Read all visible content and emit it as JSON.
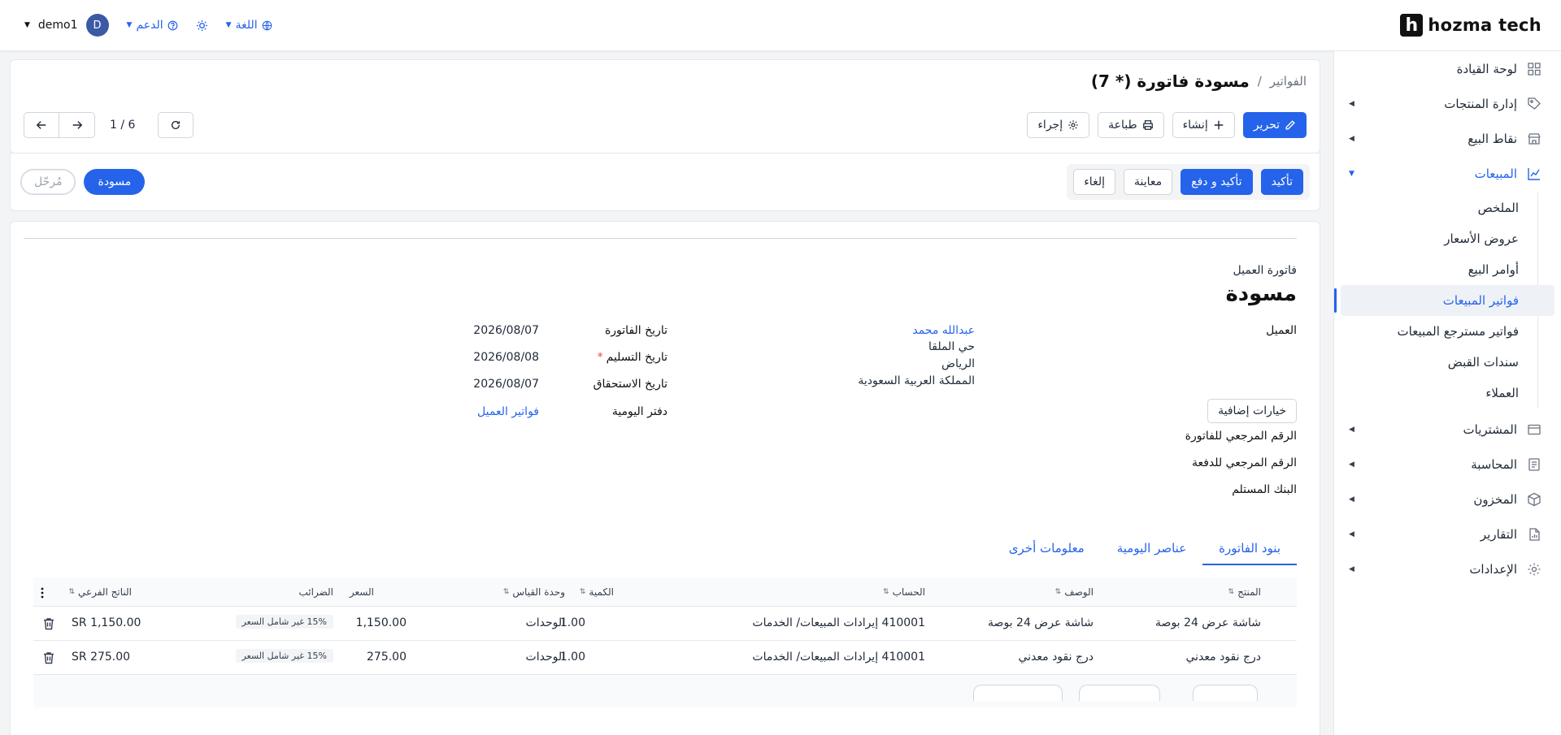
{
  "topbar": {
    "brand": "hozma tech",
    "brand_mark": "h",
    "user_name": "demo1",
    "user_initial": "D",
    "support_label": "الدعم",
    "language_label": "اللغة"
  },
  "sidebar": {
    "items": [
      {
        "label": "لوحة القيادة",
        "icon": "dashboard-icon"
      },
      {
        "label": "إدارة المنتجات",
        "icon": "tag-icon"
      },
      {
        "label": "نقاط البيع",
        "icon": "store-icon"
      },
      {
        "label": "المبيعات",
        "icon": "chart-icon"
      },
      {
        "label": "المشتريات",
        "icon": "card-icon"
      },
      {
        "label": "المحاسبة",
        "icon": "ledger-icon"
      },
      {
        "label": "المخزون",
        "icon": "box-icon"
      },
      {
        "label": "التقارير",
        "icon": "report-icon"
      },
      {
        "label": "الإعدادات",
        "icon": "gear-icon"
      }
    ],
    "sales_sub": [
      "الملخص",
      "عروض الأسعار",
      "أوامر البيع",
      "فواتير المبيعات",
      "فواتير مسترجع المبيعات",
      "سندات القبض",
      "العملاء"
    ]
  },
  "header": {
    "breadcrumb_parent": "الفواتير",
    "separator": "/",
    "title": "مسودة فاتورة (* 7)",
    "edit_label": "تحرير",
    "create_label": "إنشاء",
    "print_label": "طباعة",
    "action_label": "إجراء",
    "pager": "1 / 6"
  },
  "status_bar": {
    "confirm_label": "تأكيد",
    "confirm_pay_label": "تأكيد و دفع",
    "preview_label": "معاينة",
    "cancel_label": "إلغاء",
    "status_draft": "مسودة",
    "status_posted": "مُرحّل"
  },
  "document": {
    "type": "فاتورة العميل",
    "state": "مسودة",
    "customer_label": "العميل",
    "customer_name": "عبدالله محمد",
    "address_line1": "حي الملقا",
    "address_line2": "الرياض",
    "address_line3": "المملكة العربية السعودية",
    "invoice_date_label": "تاريخ الفاتورة",
    "invoice_date": "2026/08/07",
    "delivery_date_label": "تاريخ التسليم",
    "delivery_date": "2026/08/08",
    "due_date_label": "تاريخ الاستحقاق",
    "due_date": "2026/08/07",
    "journal_label": "دفتر اليومية",
    "journal_value": "فواتير العميل",
    "extra_options_label": "خيارات إضافية",
    "invoice_ref_label": "الرقم المرجعي للفاتورة",
    "payment_ref_label": "الرقم المرجعي للدفعة",
    "bank_label": "البنك المستلم",
    "required_mark": "*"
  },
  "tabs": [
    "بنود الفاتورة",
    "عناصر اليومية",
    "معلومات أخرى"
  ],
  "table": {
    "columns": [
      "المنتج",
      "الوصف",
      "الحساب",
      "الكمية",
      "وحدة القياس",
      "السعر",
      "الضرائب",
      "الناتج الفرعي"
    ],
    "rows": [
      {
        "product": "شاشة عرض 24 بوصة",
        "description": "شاشة عرض 24 بوصة",
        "account": "410001 إيرادات المبيعات/ الخدمات",
        "qty": "1.00",
        "uom": "الوحدات",
        "price": "1,150.00",
        "tax": "15% غير شامل السعر",
        "subtotal": "SR 1,150.00"
      },
      {
        "product": "درج نقود معدني",
        "description": "درج نقود معدني",
        "account": "410001 إيرادات المبيعات/ الخدمات",
        "qty": "1.00",
        "uom": "الوحدات",
        "price": "275.00",
        "tax": "15% غير شامل السعر",
        "subtotal": "SR 275.00"
      }
    ]
  }
}
